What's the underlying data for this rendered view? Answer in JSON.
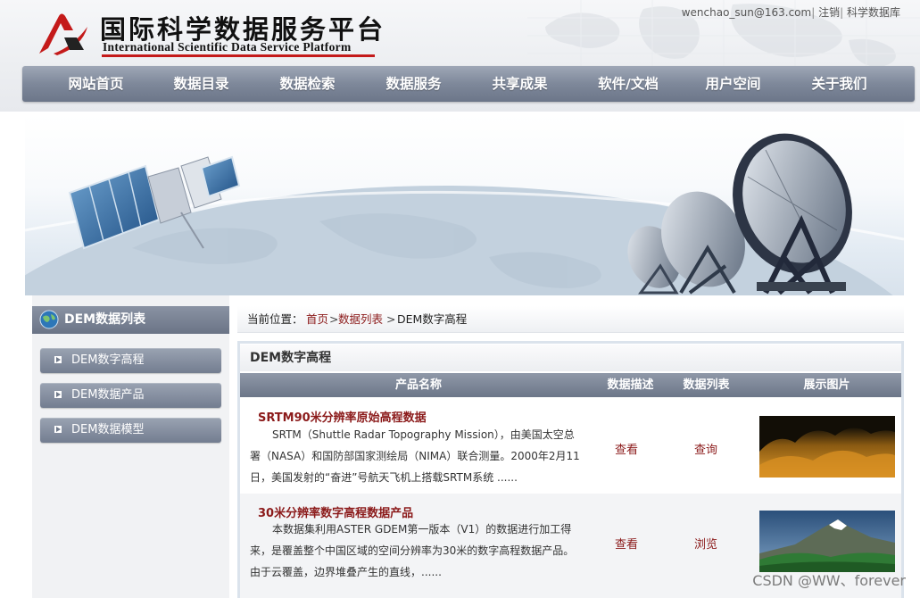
{
  "header": {
    "logo_cn": "国际科学数据服务平台",
    "logo_en": "International Scientific Data Service Platform",
    "user": "wenchao_sun@163.com",
    "logout": "注销",
    "db_link": "科学数据库",
    "sep": "|"
  },
  "nav": [
    "网站首页",
    "数据目录",
    "数据检索",
    "数据服务",
    "共享成果",
    "软件/文档",
    "用户空间",
    "关于我们"
  ],
  "sidebar": {
    "title": "DEM数据列表",
    "items": [
      "DEM数字高程",
      "DEM数据产品",
      "DEM数据模型"
    ]
  },
  "breadcrumb": {
    "label": "当前位置：",
    "crumb1": "首页",
    "arrow1": ">",
    "crumb2": "数据列表",
    "arrow2": ">",
    "current": "DEM数字高程"
  },
  "panel": {
    "title": "DEM数字高程",
    "columns": [
      "产品名称",
      "数据描述",
      "数据列表",
      "展示图片"
    ],
    "rows": [
      {
        "title": "SRTM90米分辨率原始高程数据",
        "desc": "SRTM（Shuttle Radar Topography Mission），由美国太空总署（NASA）和国防部国家测绘局（NIMA）联合测量。2000年2月11日，美国发射的“奋进”号航天飞机上搭载SRTM系统 ......",
        "desc_link": "查看",
        "list_link": "查询"
      },
      {
        "title": "30米分辨率数字高程数据产品",
        "desc": "本数据集利用ASTER GDEM第一版本（V1）的数据进行加工得来，是覆盖整个中国区域的空间分辨率为30米的数字高程数据产品。由于云覆盖，边界堆叠产生的直线，......",
        "desc_link": "查看",
        "list_link": "浏览"
      }
    ]
  },
  "watermark": "CSDN @WW、forever",
  "colors": {
    "nav": "#7e889a",
    "link": "#8b1a1a",
    "logo_red": "#c41a1a"
  }
}
